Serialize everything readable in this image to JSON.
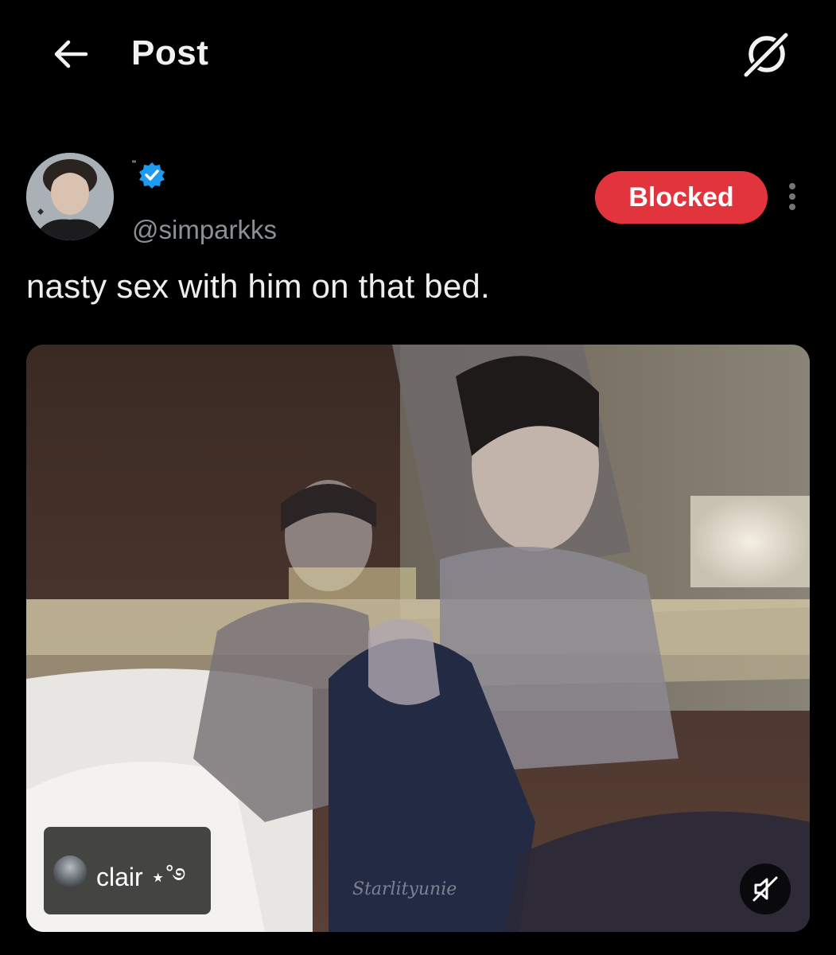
{
  "header": {
    "title": "Post",
    "back_icon": "arrow-left-icon",
    "grok_icon": "grok-icon"
  },
  "post": {
    "author": {
      "display_name": "\"",
      "handle": "@simparkks",
      "verified": true,
      "verified_color": "#1d9bf0"
    },
    "blocked_label": "Blocked",
    "blocked_color": "#e1343d",
    "more_icon": "more-vertical-icon",
    "text": "nasty sex with him on that bed.",
    "media": {
      "tagged_user": "clair ⋆˚࿔",
      "watermark": "Starlityunie",
      "mute_icon": "volume-muted-icon"
    }
  }
}
